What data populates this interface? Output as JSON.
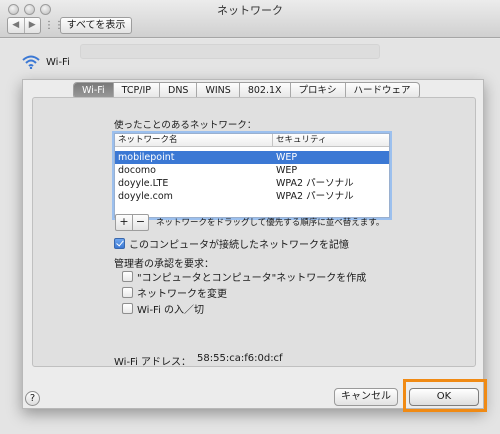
{
  "window": {
    "title": "ネットワーク",
    "back": "◀",
    "forward": "▶",
    "show_all": "すべてを表示"
  },
  "panel": {
    "service": "Wi-Fi"
  },
  "tabs": [
    {
      "label": "Wi-Fi",
      "active": true
    },
    {
      "label": "TCP/IP",
      "active": false
    },
    {
      "label": "DNS",
      "active": false
    },
    {
      "label": "WINS",
      "active": false
    },
    {
      "label": "802.1X",
      "active": false
    },
    {
      "label": "プロキシ",
      "active": false
    },
    {
      "label": "ハードウェア",
      "active": false
    }
  ],
  "networks": {
    "label": "使ったことのあるネットワーク：",
    "columns": [
      "ネットワーク名",
      "セキュリティ"
    ],
    "rows": [
      {
        "name": "mobilepoint",
        "security": "WEP",
        "selected": true
      },
      {
        "name": "docomo",
        "security": "WEP",
        "selected": false
      },
      {
        "name": "doyyle.LTE",
        "security": "WPA2 パーソナル",
        "selected": false
      },
      {
        "name": "doyyle.com",
        "security": "WPA2 パーソナル",
        "selected": false
      }
    ],
    "add": "+",
    "remove": "−",
    "drag_hint": "ネットワークをドラッグして優先する順序に並べ替えます。"
  },
  "remember": {
    "label": "このコンピュータが接続したネットワークを記憶",
    "checked": true
  },
  "admin": {
    "label": "管理者の承認を要求：",
    "options": [
      {
        "label": "\"コンピュータとコンピュータ\"ネットワークを作成",
        "checked": false
      },
      {
        "label": "ネットワークを変更",
        "checked": false
      },
      {
        "label": "Wi-Fi の入／切",
        "checked": false
      }
    ]
  },
  "address": {
    "label": "Wi-Fi アドレス：",
    "value": "58:55:ca:f6:0d:cf"
  },
  "buttons": {
    "help": "?",
    "cancel": "キャンセル",
    "ok": "OK"
  },
  "colors": {
    "highlight_frame": "#f08a14",
    "selection": "#3b78d4"
  }
}
